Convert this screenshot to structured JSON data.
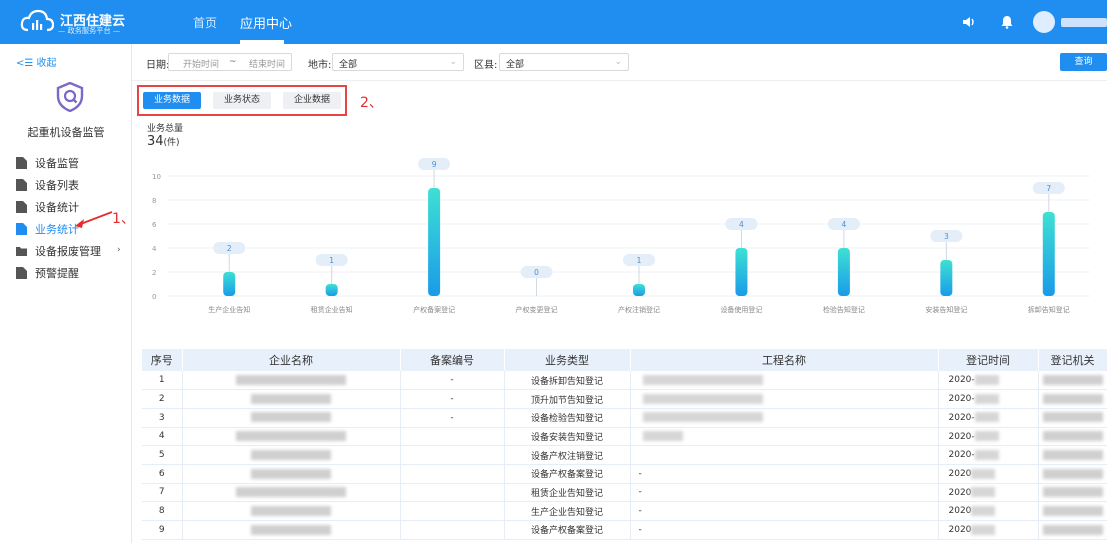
{
  "header": {
    "logo_title": "江西住建云",
    "logo_sub": "— 政务服务平台 —",
    "nav": [
      {
        "label": "首页",
        "active": false
      },
      {
        "label": "应用中心",
        "active": true
      }
    ],
    "icons": [
      "speaker-icon",
      "bell-icon",
      "avatar"
    ]
  },
  "sidebar": {
    "collapse_label": "收起",
    "module_title": "起重机设备监管",
    "items": [
      {
        "label": "设备监管",
        "icon": "file-icon",
        "active": false
      },
      {
        "label": "设备列表",
        "icon": "file-icon",
        "active": false
      },
      {
        "label": "设备统计",
        "icon": "file-icon",
        "active": false
      },
      {
        "label": "业务统计",
        "icon": "file-icon",
        "active": true
      },
      {
        "label": "设备报废管理",
        "icon": "folder-icon",
        "active": false,
        "has_children": true
      },
      {
        "label": "预警提醒",
        "icon": "file-icon",
        "active": false
      }
    ]
  },
  "annotations": {
    "a1": "1、",
    "a2": "2、"
  },
  "filters": {
    "date_label": "日期:",
    "start_placeholder": "开始时间",
    "sep": "~",
    "end_placeholder": "结束时间",
    "city_label": "地市:",
    "city_value": "全部",
    "district_label": "区县:",
    "district_value": "全部",
    "query_label": "查询"
  },
  "tabs": [
    {
      "label": "业务数据",
      "active": true
    },
    {
      "label": "业务状态",
      "active": false
    },
    {
      "label": "企业数据",
      "active": false
    }
  ],
  "summary": {
    "label": "业务总量",
    "value": "34",
    "unit": "(件)"
  },
  "chart_data": {
    "type": "bar",
    "categories": [
      "生产企业告知",
      "租赁企业告知",
      "产权备案登记",
      "产权变更登记",
      "产权注销登记",
      "设备使用登记",
      "检验告知登记",
      "安装告知登记",
      "拆卸告知登记"
    ],
    "values": [
      2,
      1,
      9,
      0,
      1,
      4,
      4,
      3,
      7
    ],
    "ylim": [
      0,
      10
    ],
    "yticks": [
      0,
      2,
      4,
      6,
      8,
      10
    ],
    "grid": true,
    "colors": {
      "bar_top": "#3ee0d4",
      "bar_bottom": "#1a9be8",
      "label_bg": "#e3eef9",
      "label_text": "#4a8fd6"
    }
  },
  "table": {
    "columns": [
      "序号",
      "企业名称",
      "备案编号",
      "业务类型",
      "工程名称",
      "登记时间",
      "登记机关"
    ],
    "rows": [
      {
        "no": "1",
        "record": "-",
        "type": "设备拆卸告知登记",
        "project": "",
        "time": "2020-"
      },
      {
        "no": "2",
        "record": "-",
        "type": "顶升加节告知登记",
        "project": "",
        "time": "2020-"
      },
      {
        "no": "3",
        "record": "-",
        "type": "设备检验告知登记",
        "project": "",
        "time": "2020-"
      },
      {
        "no": "4",
        "record": "",
        "type": "设备安装告知登记",
        "project": "",
        "time": "2020-"
      },
      {
        "no": "5",
        "record": "",
        "type": "设备产权注销登记",
        "project": "",
        "time": "2020-"
      },
      {
        "no": "6",
        "record": "",
        "type": "设备产权备案登记",
        "project": "-",
        "time": "2020"
      },
      {
        "no": "7",
        "record": "",
        "type": "租赁企业告知登记",
        "project": "-",
        "time": "2020"
      },
      {
        "no": "8",
        "record": "",
        "type": "生产企业告知登记",
        "project": "-",
        "time": "2020"
      },
      {
        "no": "9",
        "record": "",
        "type": "设备产权备案登记",
        "project": "-",
        "time": "2020"
      }
    ]
  }
}
